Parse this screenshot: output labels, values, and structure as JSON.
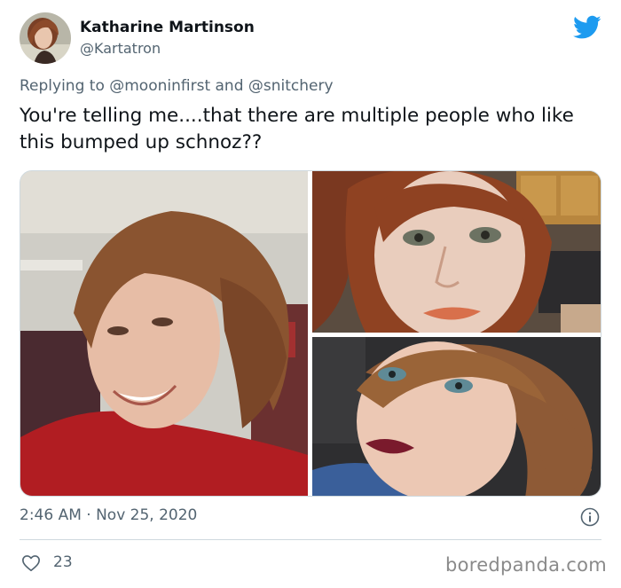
{
  "author": {
    "display_name": "Katharine Martinson",
    "handle": "@Kartatron"
  },
  "reply": {
    "prefix": "Replying to",
    "mention_1": "@mooninfirst",
    "conjunction": "and",
    "mention_2": "@snitchery"
  },
  "tweet": {
    "text": "You're telling me....that there are multiple people who like this bumped up schnoz??",
    "timestamp": "2:46 AM · Nov 25, 2020"
  },
  "engagement": {
    "likes": "23"
  },
  "watermark": "boredpanda.com",
  "icons": {
    "brand": "twitter-bird-icon",
    "info": "info-icon",
    "like": "heart-icon"
  },
  "colors": {
    "twitter_blue": "#1d9bf0",
    "text_primary": "#0f1419",
    "text_secondary": "#536471",
    "divider": "#cfd9de"
  }
}
